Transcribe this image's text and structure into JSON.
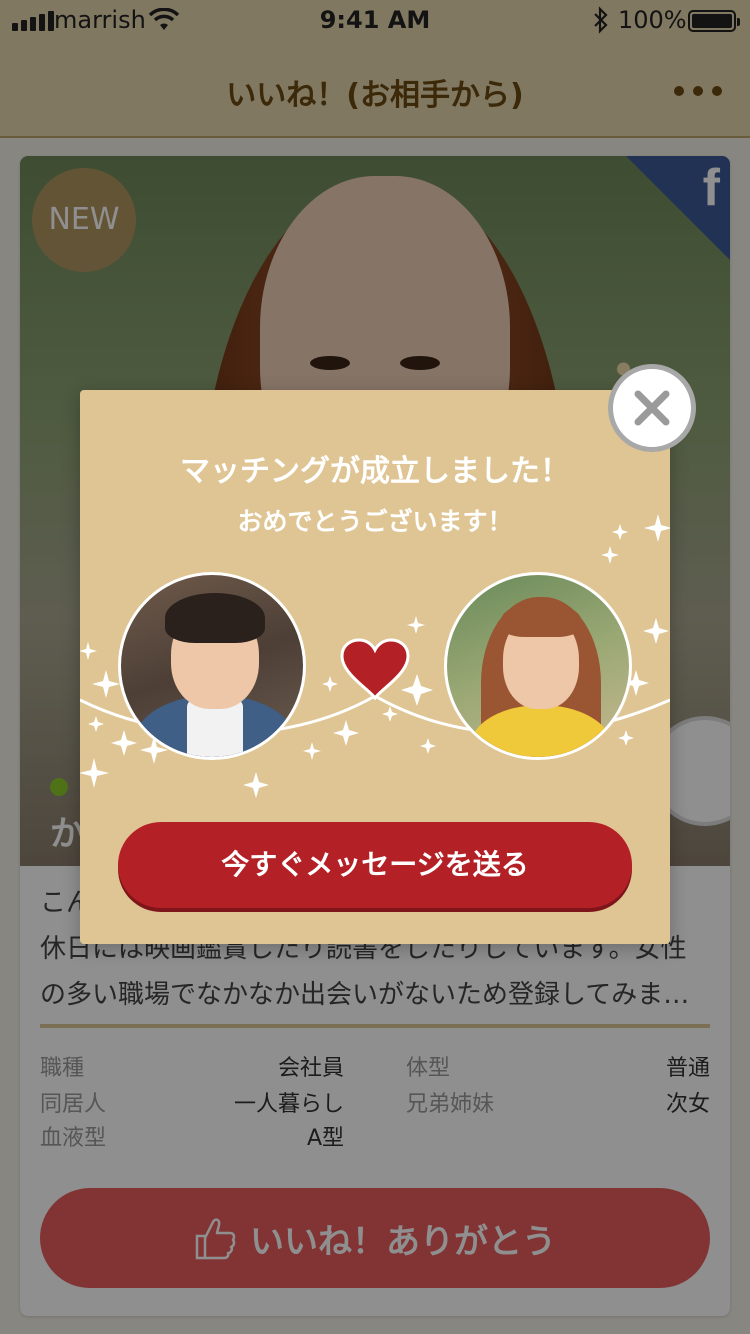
{
  "status_bar": {
    "carrier": "marrish",
    "time": "9:41 AM",
    "battery": "100%"
  },
  "header": {
    "title": "いいね！(お相手から)",
    "more_icon": "more-dots-icon"
  },
  "profile_card": {
    "badge": "NEW",
    "social_icon": "facebook-icon",
    "name_partial": "か",
    "intro_line1": "こん",
    "intro_line2": "休日には映画鑑賞したり読書をしたりしています。女性",
    "intro_line3": "の多い職場でなかなか出会いがないため登録してみま…",
    "details": [
      {
        "label": "職種",
        "value": "会社員"
      },
      {
        "label": "体型",
        "value": "普通"
      },
      {
        "label": "同居人",
        "value": "一人暮らし"
      },
      {
        "label": "兄弟姉妹",
        "value": "次女"
      },
      {
        "label": "血液型",
        "value": "A型"
      }
    ],
    "like_button": "いいね！ありがとう",
    "like_icon": "thumbs-up-icon"
  },
  "match_modal": {
    "title": "マッチングが成立しました！",
    "subtitle": "おめでとうございます！",
    "cta_label": "今すぐメッセージを送る",
    "close_icon": "close-icon",
    "heart_icon": "heart-icon"
  },
  "colors": {
    "header_bg": "#e6d6ad",
    "header_text": "#6b4a13",
    "modal_bg": "#dfc593",
    "cta_red": "#b32025",
    "like_pink": "#e85e5e",
    "facebook_blue": "#3b5998"
  }
}
